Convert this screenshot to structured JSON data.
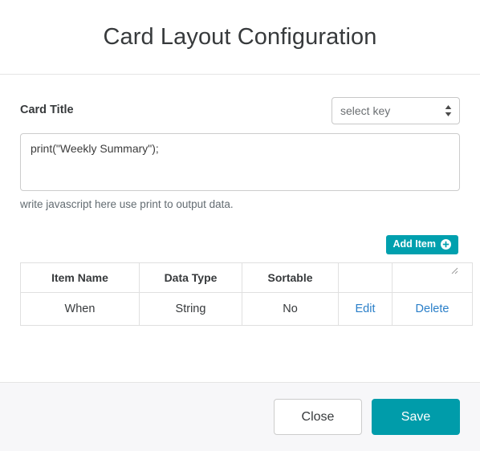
{
  "header": {
    "title": "Card Layout Configuration"
  },
  "form": {
    "card_title_label": "Card Title",
    "key_select": {
      "selected": "select key",
      "icon": "spinner-arrows-icon"
    },
    "code_editor": {
      "value": "print(\"Weekly Summary\");",
      "placeholder": "write javascript here"
    },
    "help_text": "write javascript here use print to output data."
  },
  "toolbar": {
    "add_item_label": "Add Item",
    "add_item_icon": "plus-circle-icon"
  },
  "table": {
    "columns": [
      "Item Name",
      "Data Type",
      "Sortable",
      "",
      ""
    ],
    "rows": [
      {
        "item_name": "When",
        "data_type": "String",
        "sortable": "No",
        "edit_label": "Edit",
        "delete_label": "Delete"
      }
    ]
  },
  "footer": {
    "close_label": "Close",
    "save_label": "Save"
  },
  "colors": {
    "accent_teal": "#00a0ae",
    "save_teal": "#009caa",
    "link_blue": "#2a7fc9",
    "footer_bg": "#f7f7f9",
    "border": "#e0e0e0",
    "text": "#373a3c",
    "muted_text": "#636c72"
  }
}
